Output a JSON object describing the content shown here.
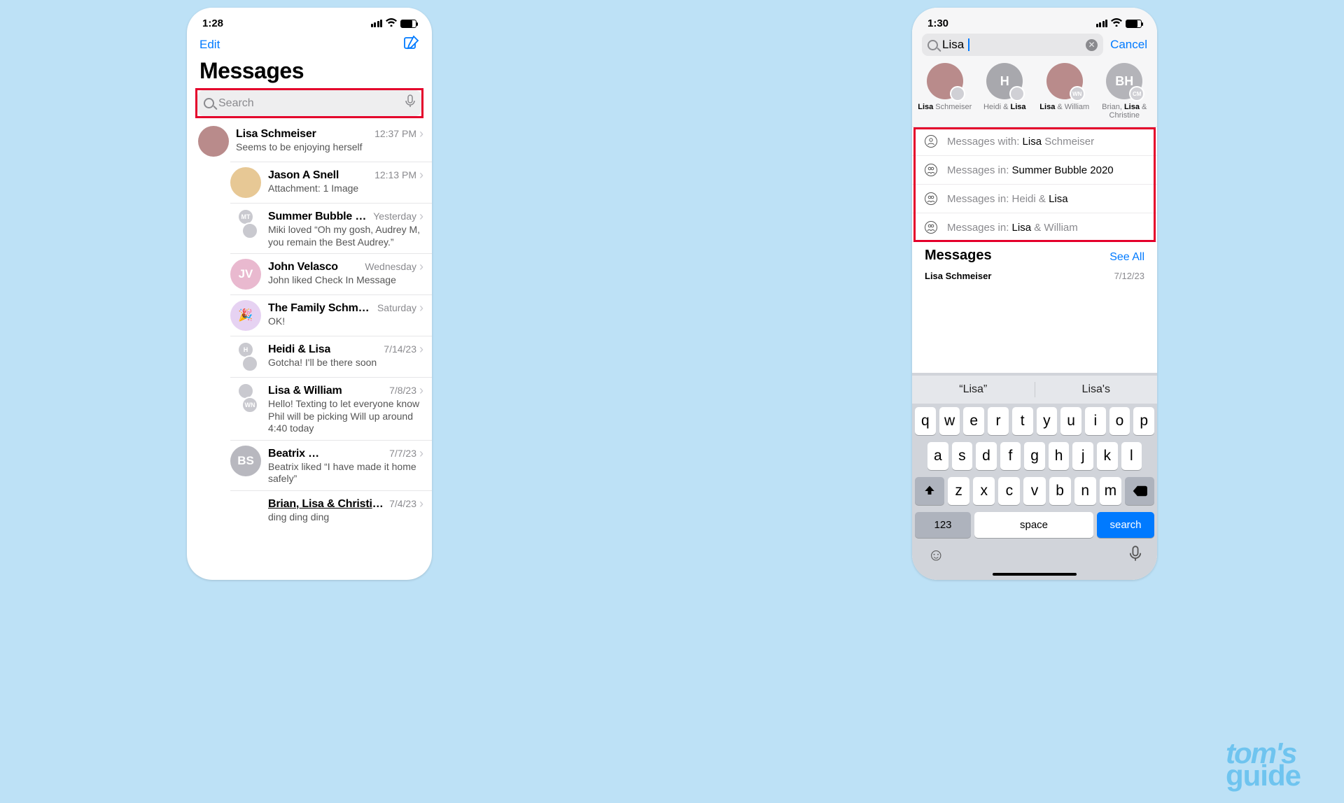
{
  "credit": {
    "line1": "tom's",
    "line2": "guide"
  },
  "left": {
    "time": "1:28",
    "edit": "Edit",
    "title": "Messages",
    "search_placeholder": "Search",
    "conversations": [
      {
        "name": "Lisa Schmeiser",
        "time": "12:37 PM",
        "snippet": "Seems to be enjoying herself",
        "avatarColor": "#b98b8b",
        "avatarText": ""
      },
      {
        "name": "Jason A Snell",
        "time": "12:13 PM",
        "snippet": "Attachment: 1 Image",
        "avatarColor": "#e7c895",
        "avatarText": ""
      },
      {
        "name": "Summer Bubble 2020",
        "time": "Yesterday",
        "snippet": "Miki loved “Oh my gosh, Audrey M, you remain the Best Audrey.”",
        "cluster": [
          "MT",
          ""
        ]
      },
      {
        "name": "John Velasco",
        "time": "Wednesday",
        "snippet": "John liked Check In Message",
        "avatarColor": "#e9b9cf",
        "avatarText": "JV"
      },
      {
        "name": "The Family Schmichaels",
        "time": "Saturday",
        "snippet": "OK!",
        "avatarColor": "#e6d2f2",
        "avatarText": "🎉"
      },
      {
        "name": "Heidi & Lisa",
        "time": "7/14/23",
        "snippet": "Gotcha! I'll be there soon",
        "cluster": [
          "H",
          ""
        ]
      },
      {
        "name": "Lisa & William",
        "time": "7/8/23",
        "snippet": "Hello! Texting to let everyone know Phil will be picking Will up around 4:40 today",
        "cluster": [
          "",
          "WN"
        ]
      },
      {
        "name": "Beatrix",
        "time": "7/7/23",
        "snippet": "Beatrix liked “I have made it home safely”",
        "avatarColor": "#b8b8bf",
        "avatarText": "BS",
        "censored": true
      },
      {
        "name": "Brian, Lisa & Christine",
        "time": "7/4/23",
        "snippet": "ding ding ding",
        "underline": true
      }
    ]
  },
  "right": {
    "time": "1:30",
    "search_value": "Lisa",
    "cancel": "Cancel",
    "contacts": [
      {
        "plain": "",
        "bold": "Lisa",
        "rest": " Schmeiser",
        "color": "#b98b8b",
        "badge": ""
      },
      {
        "plain": "Heidi & ",
        "bold": "Lisa",
        "rest": "",
        "color": "#a8a8ad",
        "text": "H",
        "badge": ""
      },
      {
        "plain": "",
        "bold": "Lisa",
        "rest": " & William",
        "color": "#b98b8b",
        "badge": "WN"
      },
      {
        "plain": "Brian, ",
        "bold": "Lisa",
        "rest": " & Christine",
        "color": "#b4b4b9",
        "text": "BH",
        "badge": "CM"
      }
    ],
    "suggestions": [
      {
        "icon": "person",
        "prefix": "Messages with: ",
        "bold": "Lisa",
        "rest": " Schmeiser"
      },
      {
        "icon": "group",
        "prefix": "Messages in: ",
        "bold": "Summer Bubble 2020",
        "rest": ""
      },
      {
        "icon": "group",
        "prefix": "Messages in: Heidi & ",
        "bold": "Lisa",
        "rest": ""
      },
      {
        "icon": "group",
        "prefix": "Messages in: ",
        "bold": "Lisa",
        "rest": " & William"
      }
    ],
    "messages_header": "Messages",
    "see_all": "See All",
    "result": {
      "name": "Lisa Schmeiser",
      "date": "7/12/23"
    },
    "predict": [
      "“Lisa”",
      "Lisa's"
    ],
    "rows": [
      [
        "q",
        "w",
        "e",
        "r",
        "t",
        "y",
        "u",
        "i",
        "o",
        "p"
      ],
      [
        "a",
        "s",
        "d",
        "f",
        "g",
        "h",
        "j",
        "k",
        "l"
      ],
      [
        "z",
        "x",
        "c",
        "v",
        "b",
        "n",
        "m"
      ]
    ],
    "numkey": "123",
    "space": "space",
    "action": "search"
  }
}
